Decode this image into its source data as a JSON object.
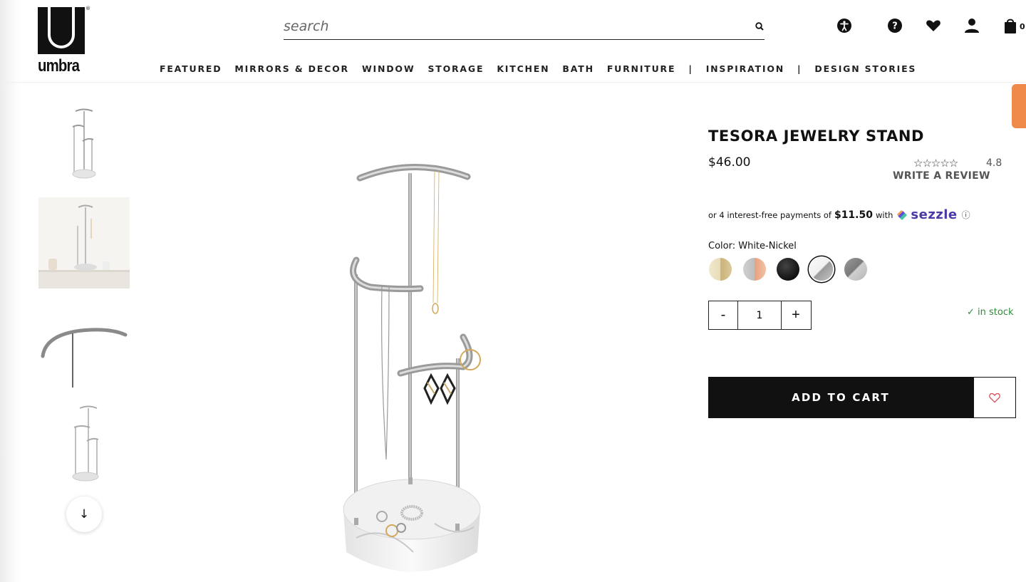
{
  "brand": {
    "name": "umbra",
    "reg_mark": "®"
  },
  "search": {
    "placeholder": "search"
  },
  "header_icons": [
    "accessibility-icon",
    "help-icon",
    "heart-icon",
    "account-icon",
    "shopping-bag-icon"
  ],
  "cart": {
    "count": "0"
  },
  "nav": {
    "featured": "FEATURED",
    "mirrors": "MIRRORS & DECOR",
    "window": "WINDOW",
    "storage": "STORAGE",
    "kitchen": "KITCHEN",
    "bath": "BATH",
    "furniture": "FURNITURE",
    "separator": "|",
    "inspiration": "INSPIRATION",
    "design_stories": "DESIGN STORIES"
  },
  "product": {
    "title": "TESORA JEWELRY STAND",
    "price": "$46.00",
    "stars": "☆☆☆☆☆",
    "rating": "4.8",
    "write_review": "WRITE A REVIEW",
    "installments_prefix": "or 4 interest-free payments of",
    "installments_amount": "$11.50",
    "installments_with": "with",
    "sezzle_name": "sezzle",
    "info_icon": "ⓘ",
    "color_label": "Color: White-Nickel",
    "quantity": "1",
    "qty_minus": "-",
    "qty_plus": "+",
    "stock_status": "in stock",
    "stock_check": "✓",
    "add_to_cart": "ADD TO CART"
  },
  "swatches": [
    {
      "name": "Brass",
      "colors": [
        "#e8dcb8",
        "#c9b27a"
      ]
    },
    {
      "name": "Copper",
      "colors": [
        "#bdbdbd",
        "#e8a07c"
      ]
    },
    {
      "name": "Black",
      "colors": [
        "#111111",
        "#333333"
      ]
    },
    {
      "name": "White-Nickel",
      "colors": [
        "#f5f5f5",
        "#9a9a9a"
      ],
      "selected": true
    },
    {
      "name": "Nickel",
      "colors": [
        "#b5b5b5",
        "#6e6e6e"
      ]
    }
  ],
  "thumb_nav": {
    "down_arrow": "↓"
  },
  "colors": {
    "accent_orange": "#f08a4b",
    "in_stock_green": "#2f8a3a",
    "button_black": "#111111"
  }
}
